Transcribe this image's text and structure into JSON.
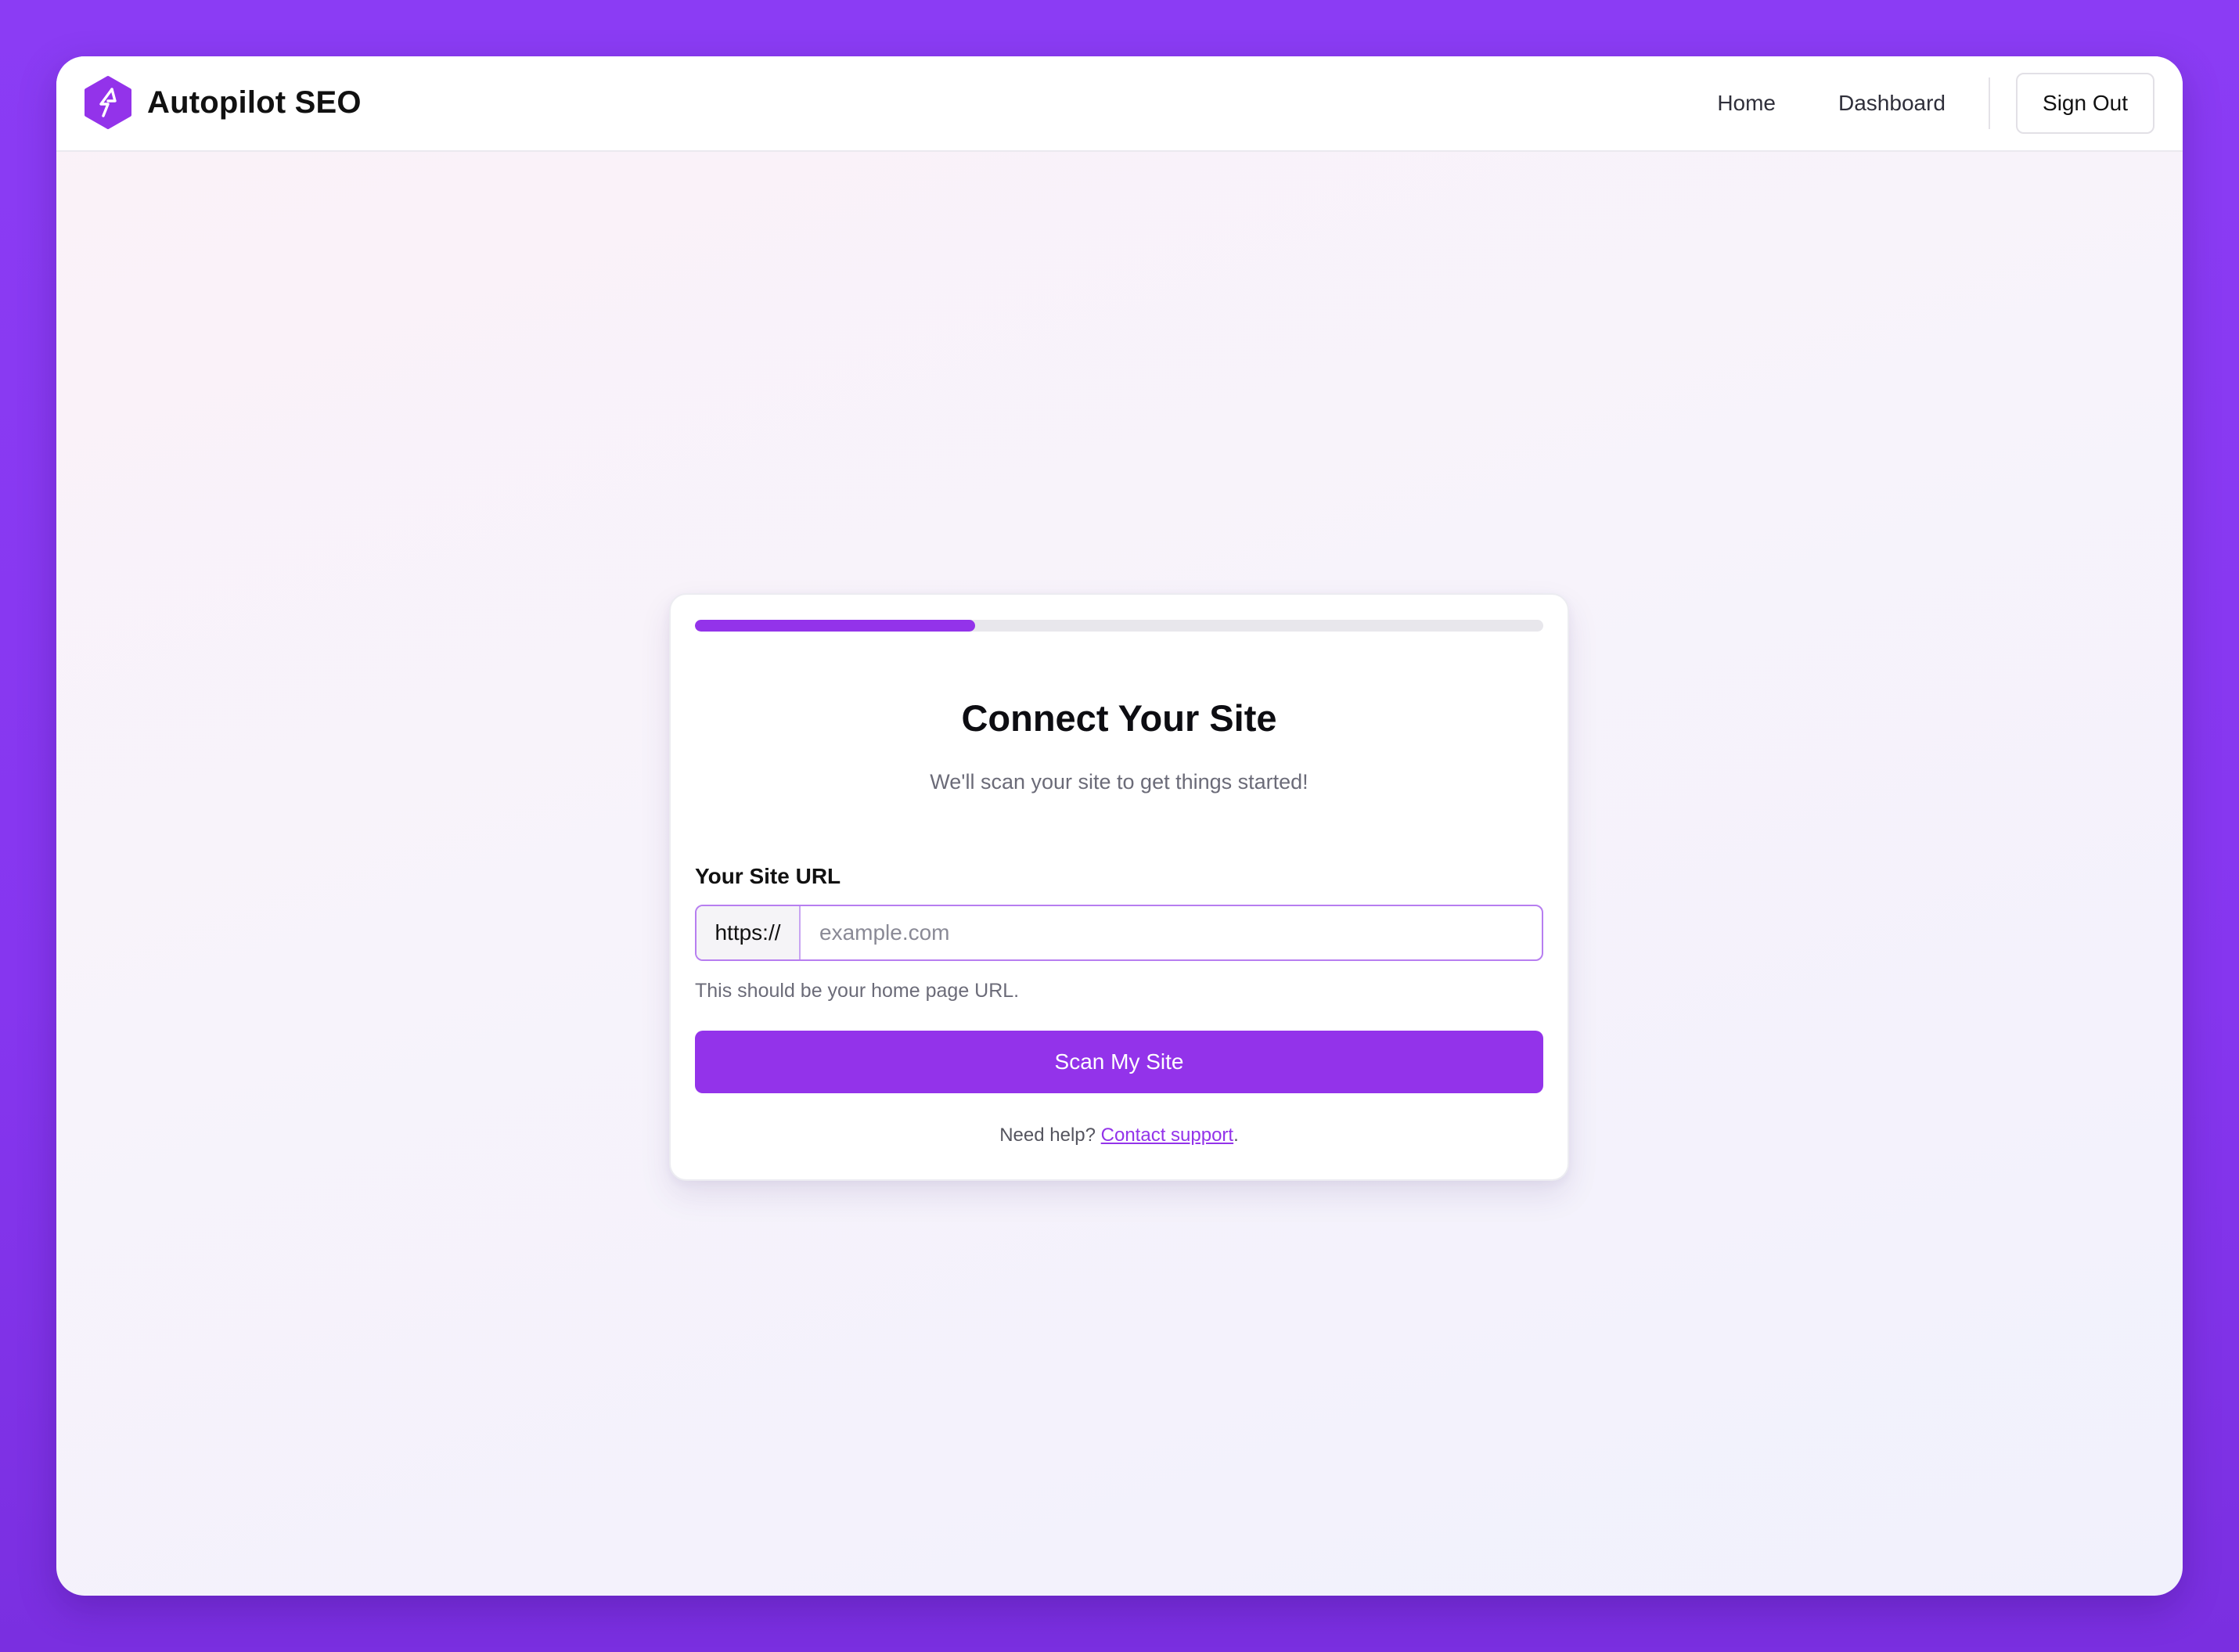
{
  "colors": {
    "accent": "#9333ea",
    "background": "#8b3cf4"
  },
  "header": {
    "brand_name": "Autopilot SEO",
    "brand_icon": "lightning-hexagon-icon",
    "nav": [
      {
        "label": "Home"
      },
      {
        "label": "Dashboard"
      }
    ],
    "sign_out_label": "Sign Out"
  },
  "onboarding": {
    "progress_percent": 33,
    "title": "Connect Your Site",
    "subtitle": "We'll scan your site to get things started!",
    "url_field": {
      "label": "Your Site URL",
      "prefix": "https://",
      "placeholder": "example.com",
      "value": "",
      "help_text": "This should be your home page URL."
    },
    "submit_label": "Scan My Site",
    "support": {
      "prefix": "Need help?",
      "link_label": "Contact support",
      "suffix": "."
    }
  }
}
